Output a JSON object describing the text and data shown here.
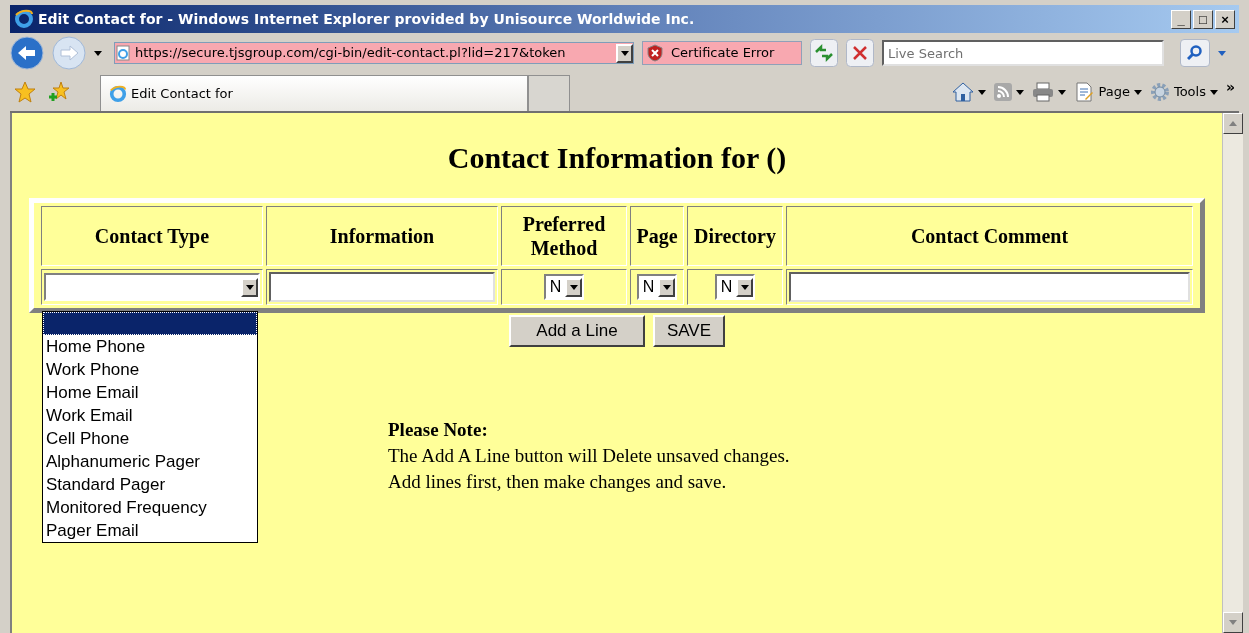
{
  "window": {
    "title": "Edit Contact for - Windows Internet Explorer provided by Unisource Worldwide Inc.",
    "controls": [
      "_",
      "□",
      "×"
    ]
  },
  "address_bar": {
    "url": "https://secure.tjsgroup.com/cgi-bin/edit-contact.pl?lid=217&token",
    "certificate": "Certificate Error"
  },
  "search": {
    "placeholder": "Live Search"
  },
  "tab": {
    "title": "Edit Contact for"
  },
  "command_bar": {
    "items": [
      {
        "kind": "home"
      },
      {
        "kind": "feed"
      },
      {
        "kind": "print"
      },
      {
        "kind": "page",
        "label": "Page"
      },
      {
        "kind": "tools",
        "label": "Tools"
      }
    ],
    "overflow": "»"
  },
  "page": {
    "heading": "Contact Information for ()",
    "table": {
      "columns": [
        "Contact Type",
        "Information",
        "Preferred Method",
        "Page",
        "Directory",
        "Contact Comment"
      ],
      "row": {
        "preferred_method": "N",
        "page": "N",
        "directory": "N"
      }
    },
    "dropdown": {
      "blank_option_highlighted": true,
      "options": [
        "Home Phone",
        "Work Phone",
        "Home Email",
        "Work Email",
        "Cell Phone",
        "Alphanumeric Pager",
        "Standard Pager",
        "Monitored Frequency",
        "Pager Email"
      ]
    },
    "buttons": [
      "Add a Line",
      "SAVE"
    ],
    "note": {
      "title": "Please Note:",
      "lines": [
        "The Add A Line button will Delete unsaved changes.",
        "Add lines first, then make changes and save."
      ]
    }
  }
}
